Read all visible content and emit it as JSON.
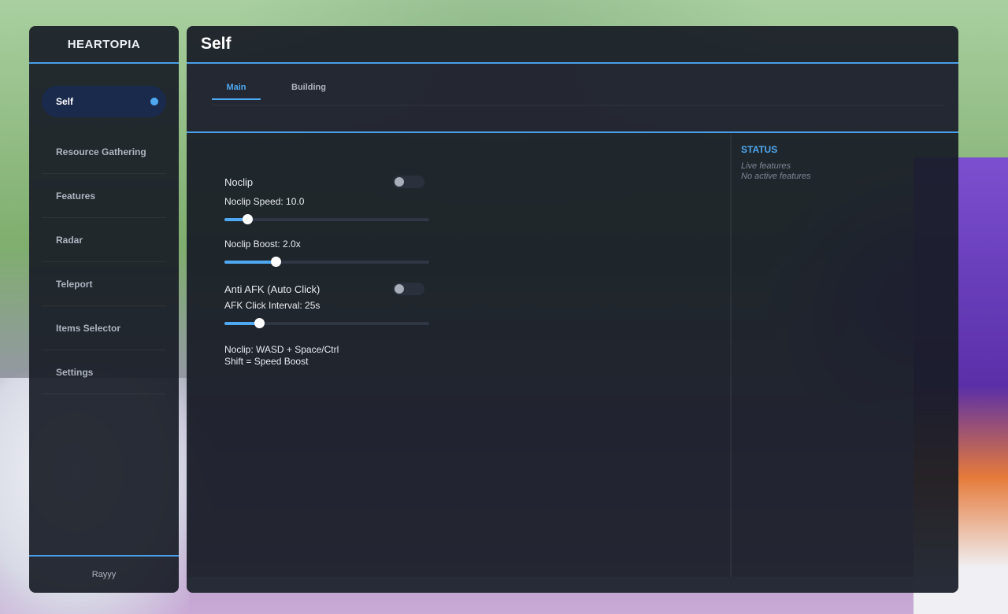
{
  "sidebar": {
    "brand": "HEARTOPIA",
    "items": [
      {
        "label": "Self",
        "active": true
      },
      {
        "label": "Resource Gathering"
      },
      {
        "label": "Features"
      },
      {
        "label": "Radar"
      },
      {
        "label": "Teleport"
      },
      {
        "label": "Items Selector"
      },
      {
        "label": "Settings"
      }
    ],
    "footer": "Rayyy"
  },
  "main": {
    "title": "Self",
    "tabs": [
      {
        "label": "Main",
        "active": true
      },
      {
        "label": "Building"
      }
    ],
    "controls": {
      "noclip": {
        "label": "Noclip",
        "enabled": false
      },
      "noclip_speed": {
        "label": "Noclip Speed: 10.0",
        "fraction": 0.11
      },
      "noclip_boost": {
        "label": "Noclip Boost: 2.0x",
        "fraction": 0.25
      },
      "anti_afk": {
        "label": "Anti AFK (Auto Click)",
        "enabled": false
      },
      "afk_interval": {
        "label": "AFK Click Interval: 25s",
        "fraction": 0.17
      },
      "hint_line1": "Noclip: WASD + Space/Ctrl",
      "hint_line2": "Shift = Speed Boost"
    },
    "status": {
      "title": "STATUS",
      "line1": "Live features",
      "line2": "No active features"
    }
  },
  "colors": {
    "accent": "#4fa8f2",
    "panel": "#181c26"
  }
}
